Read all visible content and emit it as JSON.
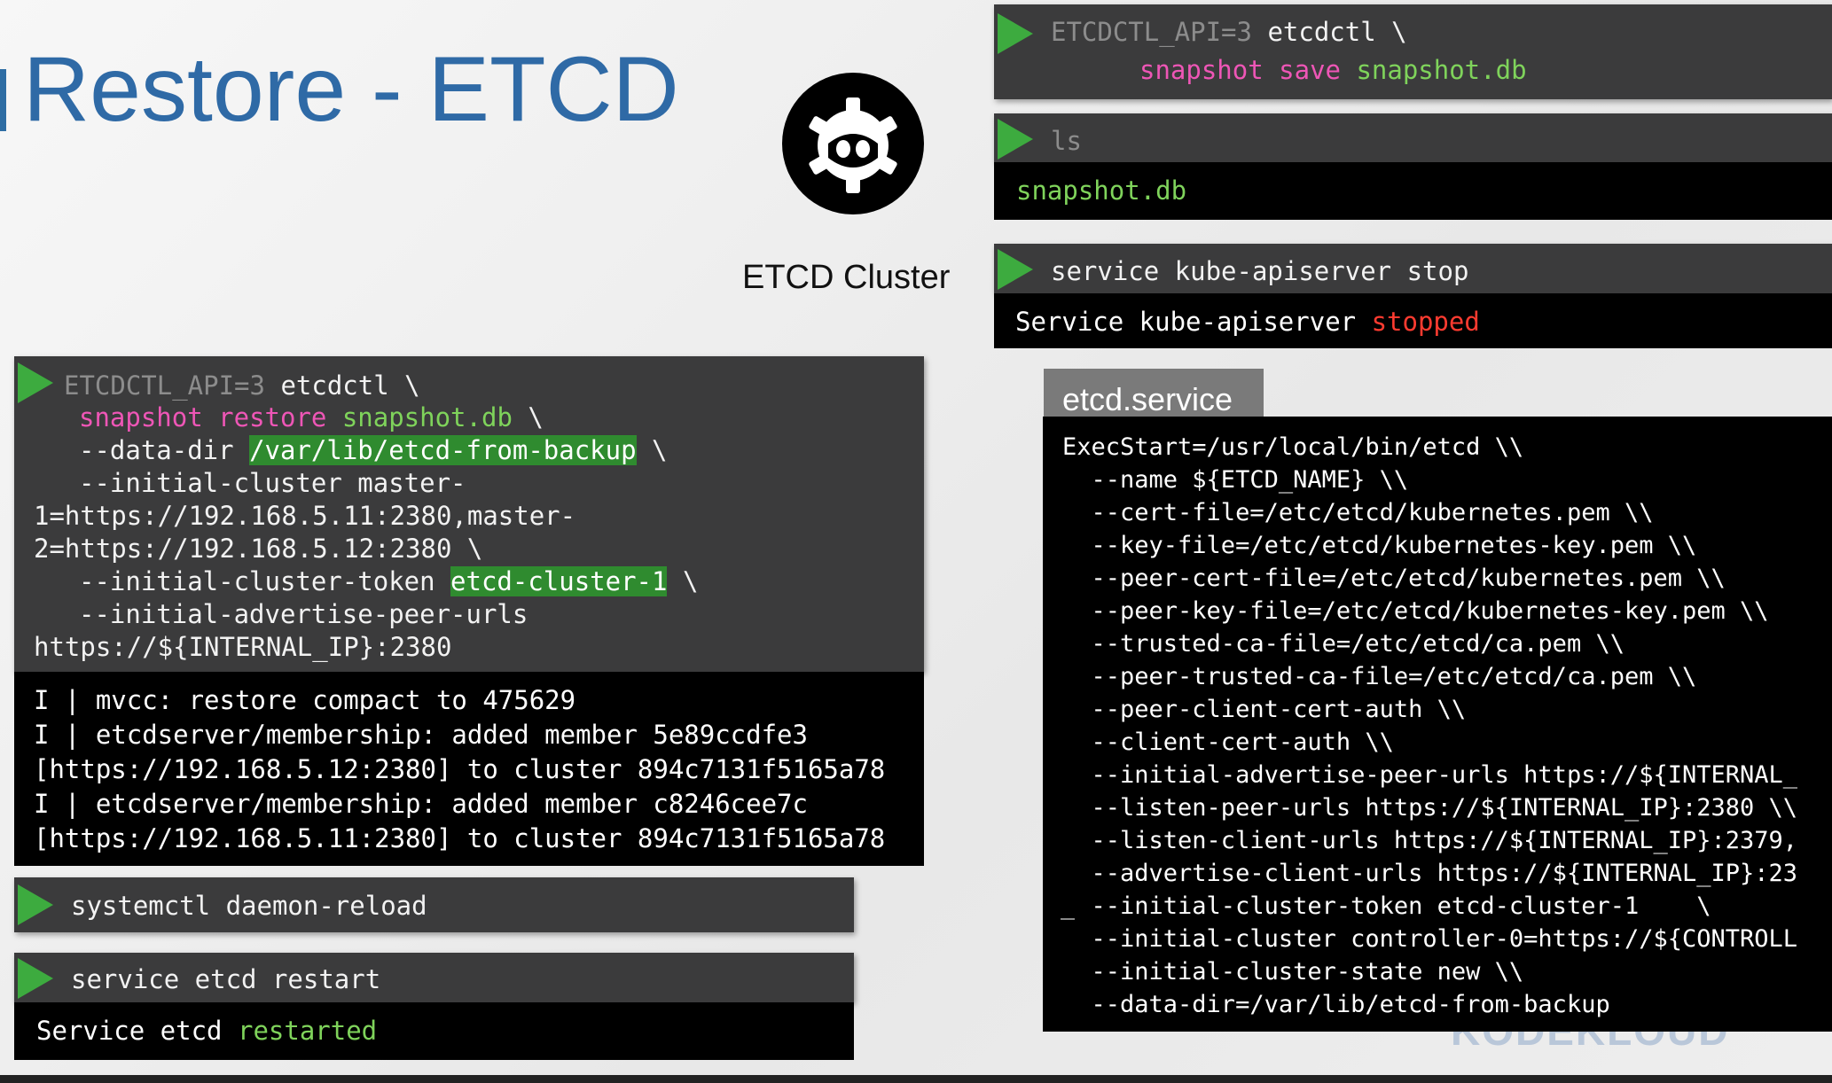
{
  "slide": {
    "title": "Restore - ETCD",
    "cluster_label": "ETCD Cluster",
    "watermark": "KODEKLOUD"
  },
  "colors": {
    "title": "#2f6aa6",
    "play": "#3dab3f",
    "command_bg": "#3b3b3c",
    "output_bg": "#000000",
    "pink": "#ee56b6",
    "green": "#7fd35b",
    "red": "#ff3b30"
  },
  "snapshot_save": {
    "icon": "play-icon",
    "env": "ETCDCTL_API=3",
    "cmd": "etcdctl",
    "cont": "\\",
    "sub": "snapshot",
    "verb": "save",
    "file": "snapshot.db"
  },
  "ls": {
    "icon": "play-icon",
    "cmd": "ls",
    "output": "snapshot.db"
  },
  "apiserver_stop": {
    "icon": "play-icon",
    "cmd": "service kube-apiserver stop",
    "output_prefix": "Service kube-apiserver",
    "output_status": "stopped"
  },
  "restore": {
    "icon": "play-icon",
    "env": "ETCDCTL_API=3",
    "cmd": "etcdctl",
    "cont": "\\",
    "sub": "snapshot",
    "verb": "restore",
    "file": "snapshot.db",
    "data_dir_flag": "--data-dir",
    "data_dir_value": "/var/lib/etcd-from-backup",
    "initial_cluster_flag": "--initial-cluster master-",
    "initial_cluster_line2": "1=https://192.168.5.11:2380,master-",
    "initial_cluster_line3": "2=https://192.168.5.12:2380",
    "token_flag": "--initial-cluster-token",
    "token_value": "etcd-cluster-1",
    "peer_urls_flag": "--initial-advertise-peer-urls",
    "peer_urls_value": "https://${INTERNAL_IP}:2380"
  },
  "restore_output": [
    "I | mvcc: restore compact to 475629",
    "I | etcdserver/membership: added member 5e89ccdfe3",
    "[https://192.168.5.12:2380] to cluster 894c7131f5165a78",
    "I | etcdserver/membership: added member c8246cee7c",
    "[https://192.168.5.11:2380] to cluster 894c7131f5165a78"
  ],
  "daemon_reload": {
    "icon": "play-icon",
    "cmd": "systemctl daemon-reload"
  },
  "etcd_restart": {
    "icon": "play-icon",
    "cmd": "service etcd restart",
    "output_prefix": "Service etcd",
    "output_status": "restarted"
  },
  "etcd_service": {
    "tab_label": "etcd.service",
    "lines": [
      "ExecStart=/usr/local/bin/etcd \\\\",
      "  --name ${ETCD_NAME} \\\\",
      "  --cert-file=/etc/etcd/kubernetes.pem \\\\",
      "  --key-file=/etc/etcd/kubernetes-key.pem \\\\",
      "  --peer-cert-file=/etc/etcd/kubernetes.pem \\\\",
      "  --peer-key-file=/etc/etcd/kubernetes-key.pem \\\\",
      "  --trusted-ca-file=/etc/etcd/ca.pem \\\\",
      "  --peer-trusted-ca-file=/etc/etcd/ca.pem \\\\",
      "  --peer-client-cert-auth \\\\",
      "  --client-cert-auth \\\\",
      "  --initial-advertise-peer-urls https://${INTERNAL_",
      "  --listen-peer-urls https://${INTERNAL_IP}:2380 \\\\",
      "  --listen-client-urls https://${INTERNAL_IP}:2379,",
      "  --advertise-client-urls https://${INTERNAL_IP}:23",
      "  --initial-cluster-token etcd-cluster-1    \\",
      "  --initial-cluster controller-0=https://${CONTROLL",
      "  --initial-cluster-state new \\\\",
      "  --data-dir=/var/lib/etcd-from-backup"
    ]
  }
}
